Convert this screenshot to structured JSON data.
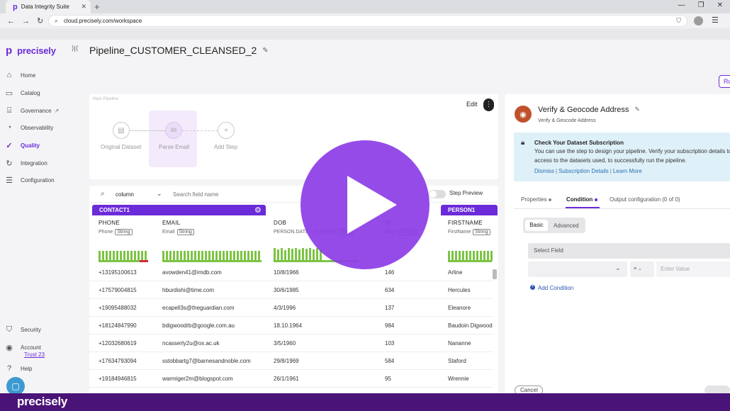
{
  "browser": {
    "tab_logo": "p",
    "tab_title": "Data Integrity Suite",
    "new_tab": "+",
    "url": "cloud.precisely.com/workspace"
  },
  "brand": {
    "logo_mark": "p",
    "name": "precisely",
    "collapse": "⟩|⟨"
  },
  "sidebar": {
    "items": [
      {
        "label": "Home",
        "icon": "home-icon"
      },
      {
        "label": "Catalog",
        "icon": "book-icon"
      },
      {
        "label": "Governance",
        "icon": "bank-icon"
      },
      {
        "label": "Observability",
        "icon": "gauge-icon"
      },
      {
        "label": "Quality",
        "icon": "check-circle-icon"
      },
      {
        "label": "Integration",
        "icon": "refresh-icon"
      },
      {
        "label": "Configuration",
        "icon": "sliders-icon"
      }
    ],
    "bottom": [
      {
        "label": "Security",
        "icon": "shield-icon"
      },
      {
        "label": "Account",
        "icon": "user-icon",
        "sub": "Trust 23"
      },
      {
        "label": "Help",
        "icon": "help-icon"
      }
    ]
  },
  "header": {
    "pipeline_title": "Pipeline_CUSTOMER_CLEANSED_2",
    "run_label": "Ru"
  },
  "flow": {
    "panel_label": "Main Pipeline",
    "edit_label": "Edit",
    "nodes": [
      "Original Dataset",
      "Parse Email",
      "Add Step"
    ]
  },
  "table": {
    "search_scope": "column",
    "search_placeholder": "Search field name",
    "step_preview_label": "Step Preview",
    "groups": [
      "CONTACT1",
      "PERSON1"
    ],
    "columns": [
      {
        "name": "PHONE",
        "sub": "Phone",
        "type": "String"
      },
      {
        "name": "EMAIL",
        "sub": "Email",
        "type": "String"
      },
      {
        "name": "DOB",
        "sub": "PERSON.DATE_OF_BIRTH",
        "type": "Date"
      },
      {
        "name": "ID",
        "sub": "none",
        "type": "Integer"
      },
      {
        "name": "FIRSTNAME",
        "sub": "FirstName",
        "type": "String"
      }
    ],
    "rows": [
      [
        "+13195100613",
        "avowden41@imdb.com",
        "10/8/1966",
        "146",
        "Arline"
      ],
      [
        "+17579004815",
        "hburdishi@time.com",
        "30/6/1985",
        "634",
        "Hercules"
      ],
      [
        "+19095488032",
        "ecapell3s@theguardian.com",
        "4/3/1996",
        "137",
        "Eleanore"
      ],
      [
        "+18124847990",
        "bdigwoodrb@google.com.au",
        "18.10.1964",
        "984",
        "Baudoin Digwood"
      ],
      [
        "+12032680619",
        "ncasserly2u@ox.ac.uk",
        "3/5/1960",
        "103",
        "Nananne"
      ],
      [
        "+17634793094",
        "sstobbartg7@barnesandnoble.com",
        "29/8/1969",
        "584",
        "Staford"
      ],
      [
        "+19184946815",
        "warmiger2m@blogspot.com",
        "26/1/1961",
        "95",
        "Wrennie"
      ]
    ]
  },
  "step_panel": {
    "title": "Verify & Geocode Address",
    "subtitle": "Verify & Geocode Address",
    "notice_title": "Check Your Dataset Subscription",
    "notice_line1": "You can use the step to design your pipeline. Verify your subscription details to",
    "notice_line2": "access to the datasets used, to successfully run the pipeline.",
    "links": [
      "Dismiss",
      "Subscription Details",
      "Learn More"
    ],
    "link_sep": "|",
    "tabs": [
      "Properties",
      "Condition",
      "Output configuration (0 of 0)"
    ],
    "active_tab": "Condition",
    "mode_basic": "Basic",
    "mode_advanced": "Advanced",
    "select_field_placeholder": "Select Field",
    "operator_icon": "≡",
    "enter_value_placeholder": "Enter Value",
    "add_condition": "Add Condition",
    "cancel": "Cancel"
  },
  "footer": {
    "logo": "precisely"
  },
  "colors": {
    "accent": "#6b2bd9",
    "footer": "#4a1377",
    "bar_green": "#7cc444",
    "bar_red": "#d7263d"
  }
}
